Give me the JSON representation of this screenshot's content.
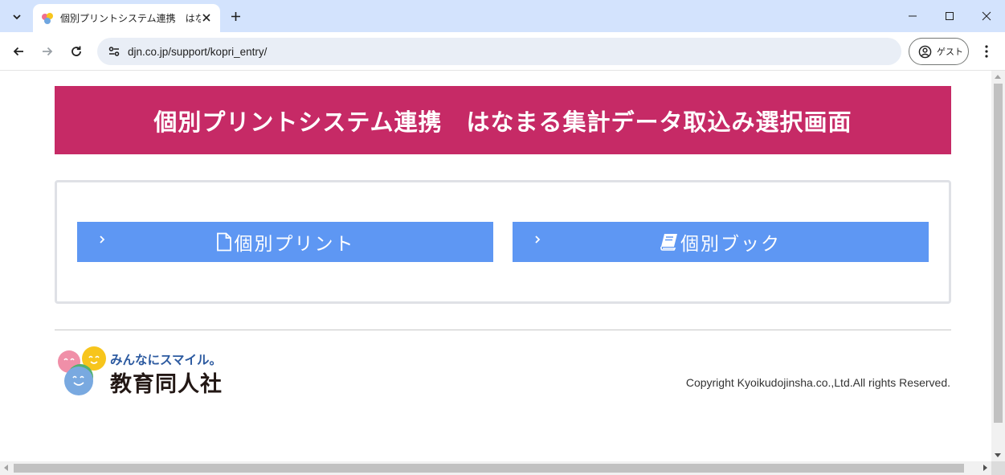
{
  "browser": {
    "tab_title": "個別プリントシステム連携　はなまる",
    "url": "djn.co.jp/support/kopri_entry/",
    "profile_label": "ゲスト"
  },
  "page": {
    "title": "個別プリントシステム連携　はなまる集計データ取込み選択画面",
    "buttons": [
      {
        "label": "個別プリント",
        "icon": "file-icon"
      },
      {
        "label": "個別ブック",
        "icon": "book-icon"
      }
    ],
    "logo": {
      "tagline": "みんなにスマイル。",
      "name": "教育同人社"
    },
    "copyright": "Copyright Kyoikudojinsha.co.,Ltd.All rights Reserved."
  },
  "colors": {
    "header_bg": "#c62a66",
    "button_bg": "#5e97f3",
    "tabbar_bg": "#d3e3fd"
  }
}
